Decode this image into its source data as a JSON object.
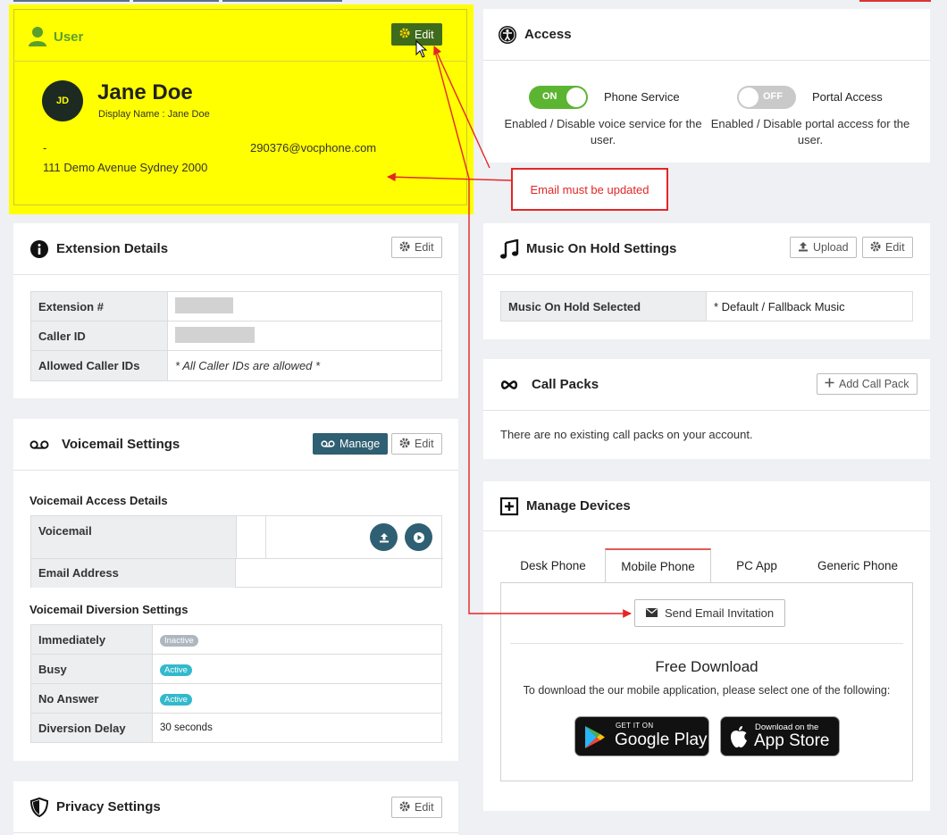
{
  "user": {
    "title": "User",
    "edit_label": "Edit",
    "initials": "JD",
    "name": "Jane Doe",
    "display_name": "Display Name : Jane Doe",
    "phone": "-",
    "email": "290376@vocphone.com",
    "address": "111 Demo Avenue Sydney 2000"
  },
  "access": {
    "title": "Access",
    "phone_service": {
      "state": "ON",
      "label": "Phone Service",
      "desc": "Enabled / Disable voice service for the user."
    },
    "portal_access": {
      "state": "OFF",
      "label": "Portal Access",
      "desc": "Enabled / Disable portal access for the user."
    }
  },
  "annotation": {
    "text": "Email must be updated"
  },
  "extension": {
    "title": "Extension Details",
    "edit_label": "Edit",
    "rows": [
      {
        "key": "Extension #",
        "value": ""
      },
      {
        "key": "Caller ID",
        "value": ""
      },
      {
        "key": "Allowed Caller IDs",
        "value": "* All Caller IDs are allowed *"
      }
    ]
  },
  "moh": {
    "title": "Music On Hold Settings",
    "upload_label": "Upload",
    "edit_label": "Edit",
    "key": "Music On Hold Selected",
    "value": "* Default / Fallback Music"
  },
  "callpacks": {
    "title": "Call Packs",
    "add_label": "Add Call Pack",
    "empty": "There are no existing call packs on your account."
  },
  "voicemail": {
    "title": "Voicemail Settings",
    "manage_label": "Manage",
    "edit_label": "Edit",
    "access_heading": "Voicemail Access Details",
    "voicemail_key": "Voicemail",
    "email_key": "Email Address",
    "diversion_heading": "Voicemail Diversion Settings",
    "diversion": [
      {
        "key": "Immediately",
        "status": "Inactive"
      },
      {
        "key": "Busy",
        "status": "Active"
      },
      {
        "key": "No Answer",
        "status": "Active"
      }
    ],
    "delay_key": "Diversion Delay",
    "delay_value": "30 seconds"
  },
  "devices": {
    "title": "Manage Devices",
    "tabs": [
      "Desk Phone",
      "Mobile Phone",
      "PC App",
      "Generic Phone"
    ],
    "active_tab": "Mobile Phone",
    "send_label": "Send Email Invitation",
    "free_title": "Free Download",
    "free_desc": "To download the our mobile application, please select one of the following:",
    "google_small": "GET IT ON",
    "google_big": "Google Play",
    "apple_small": "Download on the",
    "apple_big": "App Store"
  },
  "privacy": {
    "title": "Privacy Settings",
    "edit_label": "Edit"
  },
  "colors": {
    "highlight": "#ffff00",
    "accent_green": "#5aa02c",
    "toggle_on": "#5cb531",
    "annotation_red": "#e32626",
    "badge_active": "#32b9cc",
    "badge_inactive": "#aeb6c0"
  }
}
